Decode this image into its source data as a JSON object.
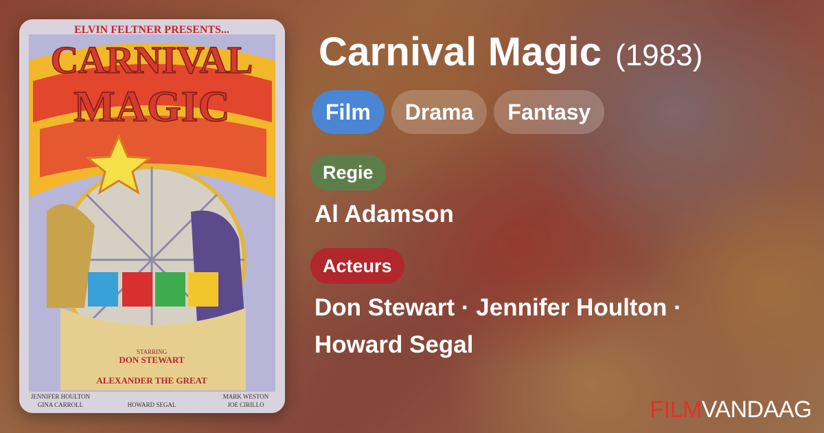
{
  "movie": {
    "title": "Carnival Magic",
    "year": "(1983)",
    "tags": [
      "Film",
      "Drama",
      "Fantasy"
    ],
    "director_label": "Regie",
    "director": "Al Adamson",
    "actors_label": "Acteurs",
    "actors_line1": "Don Stewart · Jennifer Houlton ·",
    "actors_line2": "Howard Segal"
  },
  "poster": {
    "presents": "ELVIN FELTNER PRESENTS...",
    "title_top": "CARNIVAL",
    "title_bottom": "MAGIC",
    "starring": "STARRING",
    "lead": "DON STEWART",
    "costar": "ALEXANDER THE GREAT",
    "credits_left": [
      "JENNIFER HOULTON",
      "GINA CARROLL"
    ],
    "credits_mid": "HOWARD SEGAL",
    "credits_right": [
      "MARK WESTON",
      "JOE CIRILLO"
    ]
  },
  "brand": {
    "part1": "FILM",
    "part2": "VANDAAG"
  },
  "colors": {
    "tag_primary": "#4a86d4",
    "regie": "#5d7e4a",
    "acteurs": "#b1272c",
    "brand_red": "#e0322e"
  }
}
